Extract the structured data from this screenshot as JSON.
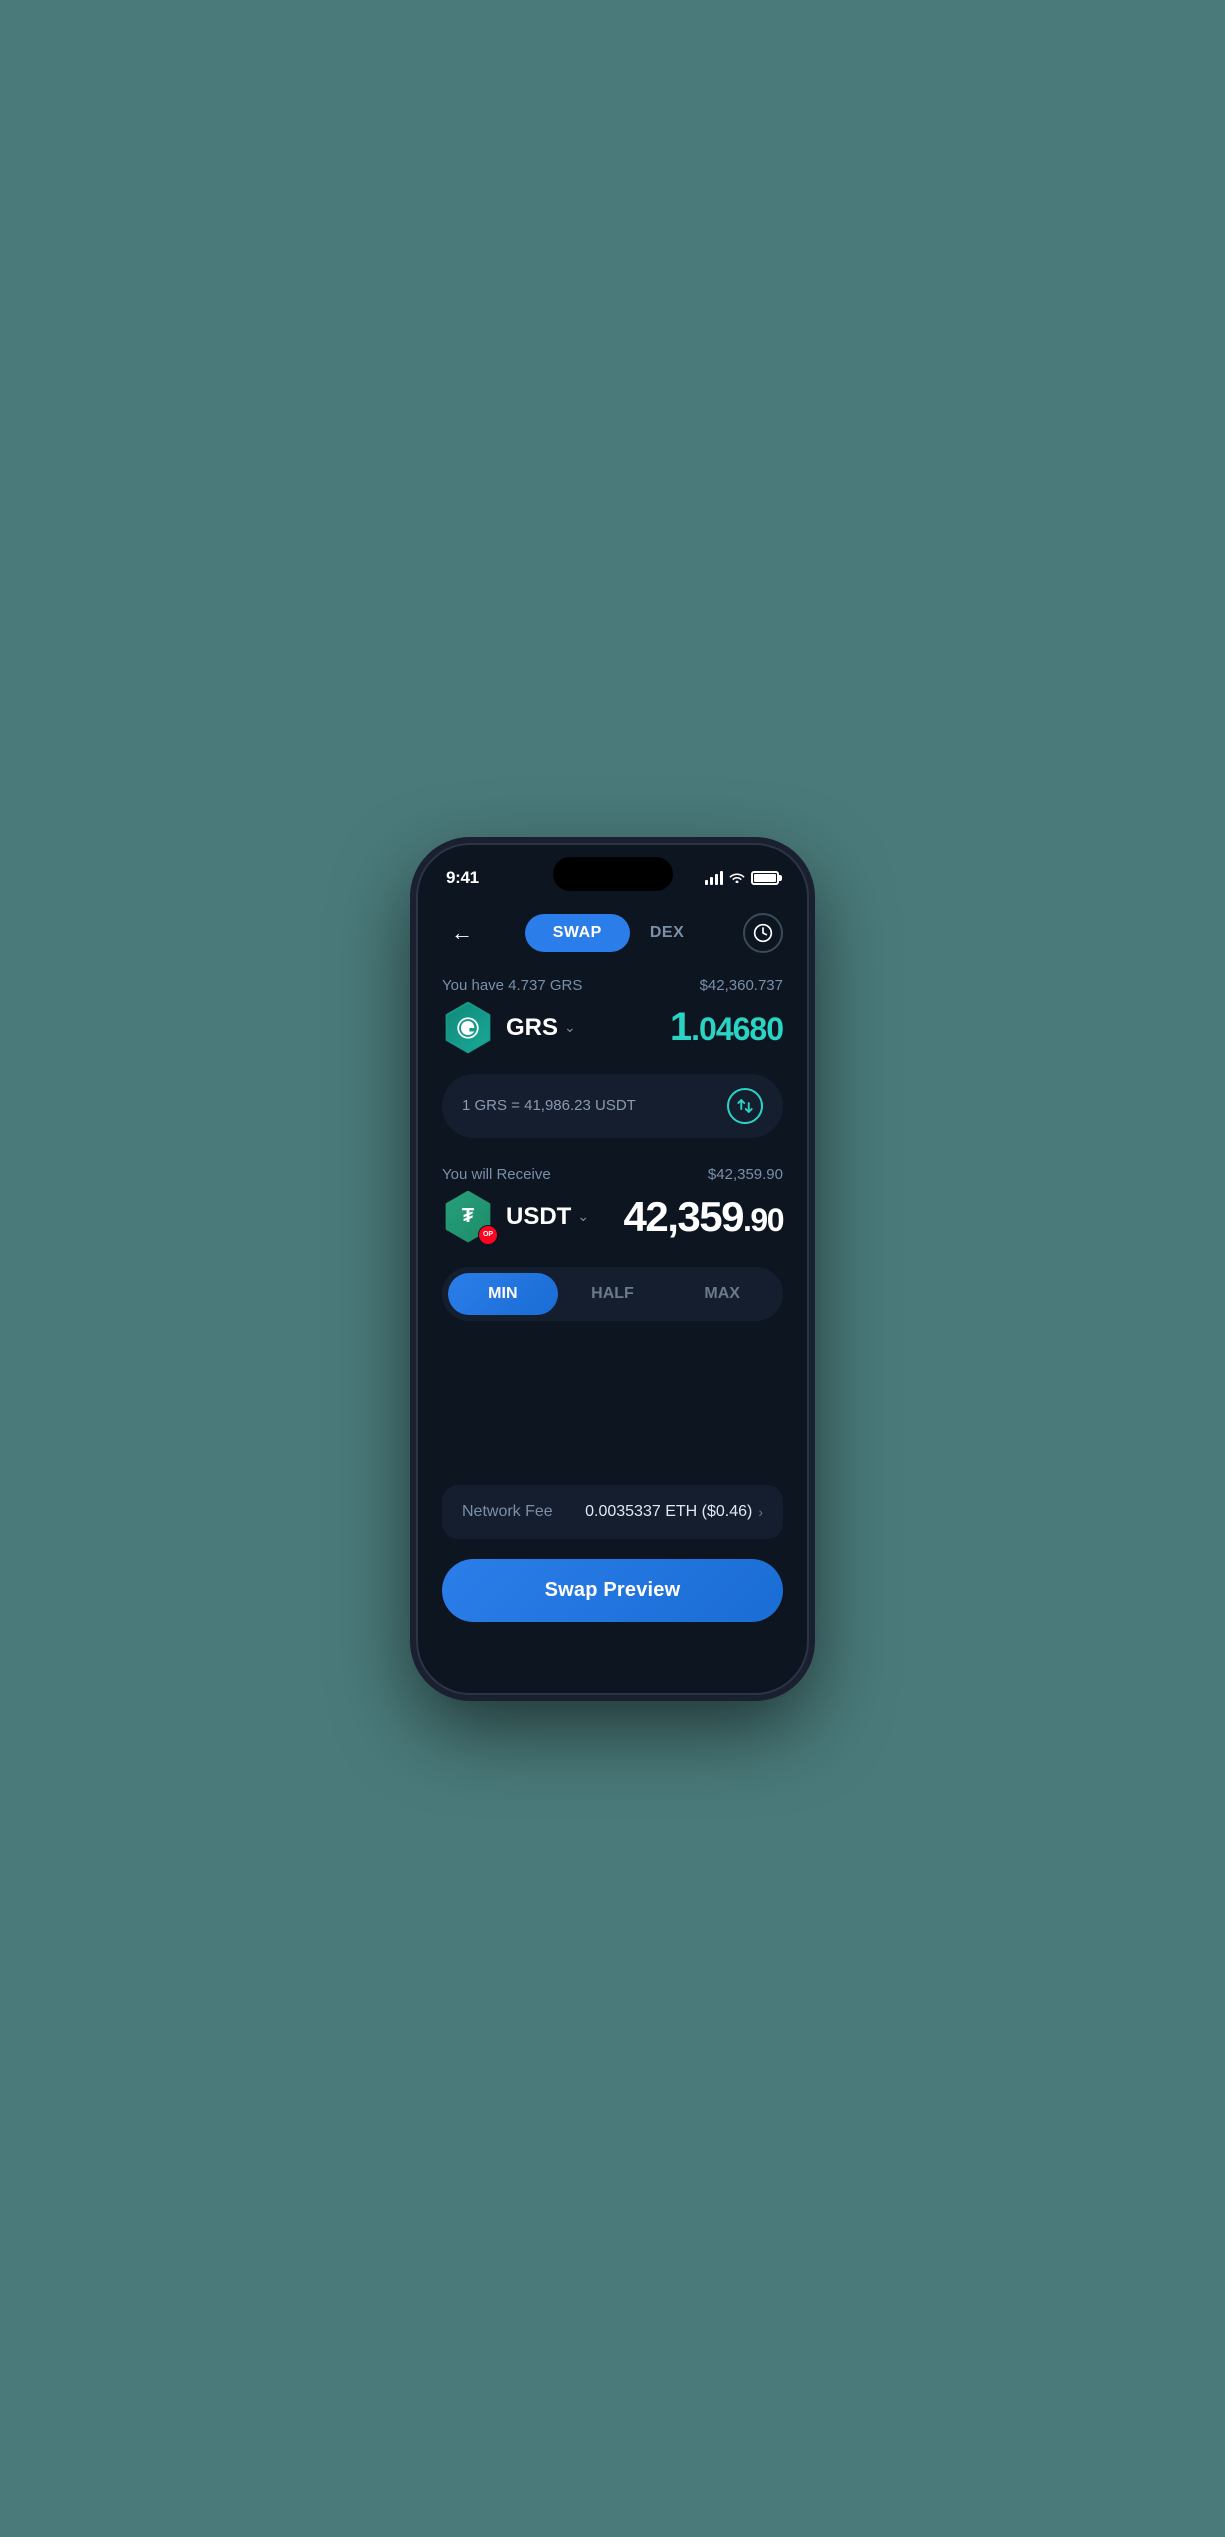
{
  "status_bar": {
    "time": "9:41"
  },
  "header": {
    "back_label": "←",
    "tab_swap": "SWAP",
    "tab_dex": "DEX",
    "history_icon": "🕐"
  },
  "from_section": {
    "balance_label": "You have 4.737 GRS",
    "balance_usd": "$42,360.737",
    "token_symbol": "GRS",
    "token_icon": "⬡",
    "amount_whole": "1",
    "amount_decimal": ".04680"
  },
  "exchange_rate": {
    "text": "1 GRS = 41,986.23 USDT"
  },
  "to_section": {
    "receive_label": "You will Receive",
    "receive_usd": "$42,359.90",
    "token_symbol": "USDT",
    "op_badge": "OP",
    "amount_whole": "42,359",
    "amount_decimal": ".90"
  },
  "amount_buttons": {
    "min_label": "MIN",
    "half_label": "HALF",
    "max_label": "MAX"
  },
  "network_fee": {
    "label": "Network Fee",
    "value": "0.0035337 ETH ($0.46)"
  },
  "swap_preview": {
    "label": "Swap Preview"
  },
  "colors": {
    "accent_blue": "#2b7de9",
    "accent_teal": "#2ad4c4",
    "background": "#0d1520",
    "card_bg": "#141e2e",
    "text_muted": "#7a8fa8",
    "usdt_green": "#26a17b",
    "op_red": "#ff0420"
  }
}
